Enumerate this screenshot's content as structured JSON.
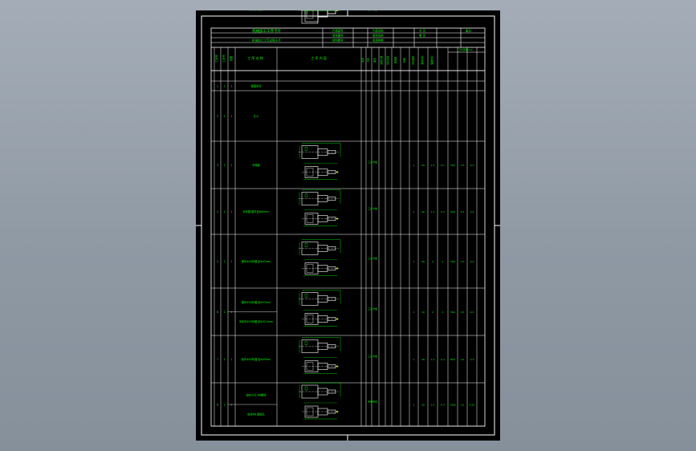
{
  "viewport": {
    "background": "#97a0aa",
    "sheet_background": "#000000"
  },
  "colors": {
    "frame": "#ffffff",
    "text": "#00ff00",
    "geometry": "#ffffff",
    "dimension": "#00ff00",
    "accent": "#ffff00"
  },
  "title_block": {
    "main_title": "机械加工工序卡片",
    "subtitle": "机械加工工艺过程卡片",
    "cells_a": [
      "产品型号",
      "零件图号",
      "材料牌号"
    ],
    "cells_b": [
      "产品名称",
      "零件名称",
      "毛坯种类"
    ],
    "cells_c": [
      "共 页",
      "第 页",
      "备注"
    ]
  },
  "headers": {
    "seq": "工序号",
    "step": "工步号",
    "device": "设备",
    "name": "工 序 名 称",
    "content": "工 序 内 容",
    "extra": [
      "夹具",
      "刀具",
      "量具",
      "进给次数",
      "切削深度",
      "进给量",
      "转速",
      "切削速度",
      "基本时间",
      "辅助时间"
    ],
    "time_group": "工时定额/min"
  },
  "rows": [
    {
      "no": "1",
      "step": "1",
      "name": "锻造毛坯"
    },
    {
      "no": "2",
      "step": "1",
      "name": "正火"
    },
    {
      "no": "3",
      "step": "1",
      "name": "车端面",
      "fixture": "三爪卡盘",
      "vals": [
        "1",
        "20",
        "1.5",
        "0.1",
        "500",
        "0.3",
        "0.3"
      ]
    },
    {
      "no": "4",
      "step": "1",
      "name": "车外圆 粗车至Φ60mm",
      "fixture": "三爪卡盘",
      "vals": [
        "1",
        "42",
        "1.5",
        "0.3",
        "500",
        "0.3",
        "0.4"
      ]
    },
    {
      "no": "5",
      "step": "1",
      "name": "粗车Φ45外圆 至Φ47mm",
      "fixture": "三爪卡盘",
      "vals": [
        "1",
        "20",
        "2",
        "1",
        "500",
        "0.3",
        "0.3"
      ]
    },
    {
      "no": "6",
      "step": "1",
      "name": "粗车Φ35外圆 至Φ37mm",
      "sub_name": "半精车Φ35外圆 至Φ35.5mm",
      "fixture": "三爪卡盘",
      "vals": [
        "1",
        "10",
        "2",
        "1",
        "500",
        "0.3",
        "0.3"
      ]
    },
    {
      "no": "7",
      "step": "1",
      "name": "精车Φ45外圆 至Φ45mm",
      "fixture": "三爪卡盘",
      "vals": [
        "1",
        "20",
        "1.5",
        "0.4",
        "800",
        "0.2",
        "0.3"
      ]
    },
    {
      "no": "8",
      "step": "1",
      "name": "钻Φ20孔 M8螺纹",
      "sub_name": "攻丝M8 螺纹孔",
      "fixture": "专用夹具",
      "vals": [
        "1",
        "20",
        "1.5",
        "0.4",
        "1000",
        "0.2",
        "0.15"
      ]
    },
    {
      "no": "9",
      "step": "1",
      "name": "去毛刺检验",
      "fixture": "三爪卡盘",
      "vals": [
        "1",
        "20",
        "1.5",
        "0.4",
        "1000",
        "0.2",
        "0.3"
      ]
    }
  ]
}
